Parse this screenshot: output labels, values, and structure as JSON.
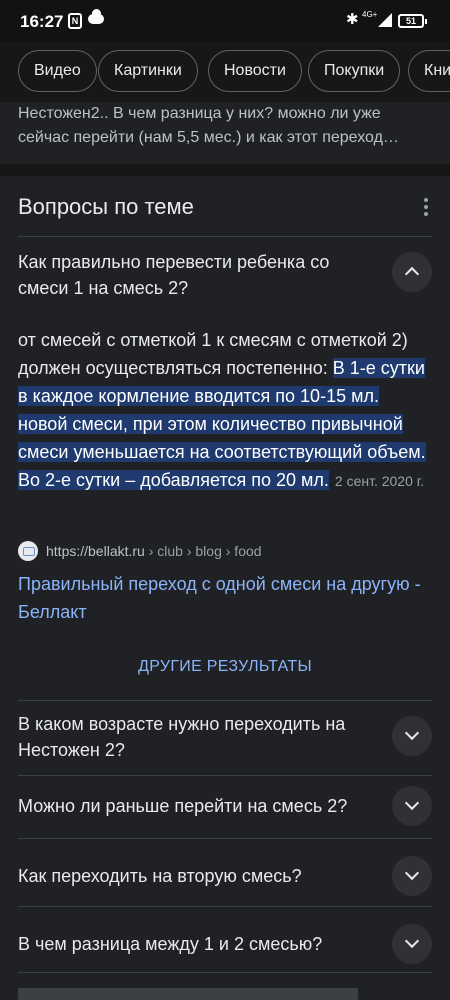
{
  "status_bar": {
    "time": "16:27",
    "nfc_label": "N",
    "network": "4G+",
    "battery": "51"
  },
  "search_chips": [
    "Видео",
    "Картинки",
    "Новости",
    "Покупки",
    "Кни"
  ],
  "prev_snippet": "Нестожен2.. В чем разница у них? можно ли уже сейчас перейти (нам 5,5 мес.) и как этот переход…",
  "related_questions": {
    "title": "Вопросы по теме",
    "expanded": {
      "question": "Как правильно перевести ребенка со смеси 1 на смесь 2?",
      "answer_plain": "от смесей с отметкой 1 к смесям с отметкой 2) должен осуществляться постепенно: ",
      "answer_highlight_1": "В 1-е сутки в каждое кормление вводится по 10-15 мл. новой смеси, при этом количество привычной смеси уменьшается на соответствующий объем.",
      "answer_between": " ",
      "answer_highlight_2": "Во 2-е сутки – добавляется по 20 мл.",
      "date": "2 сент. 2020 г.",
      "source_url": "https://bellakt.ru",
      "source_crumbs": " › club › blog › food",
      "result_title": "Правильный переход с одной смеси на другую - Беллакт"
    },
    "more_results": "ДРУГИЕ РЕЗУЛЬТАТЫ",
    "collapsed": [
      "В каком возрасте нужно переходить на Нестожен 2?",
      "Можно ли раньше перейти на смесь 2?",
      "Как переходить на вторую смесь?",
      "В чем разница между 1 и 2 смесью?"
    ]
  }
}
